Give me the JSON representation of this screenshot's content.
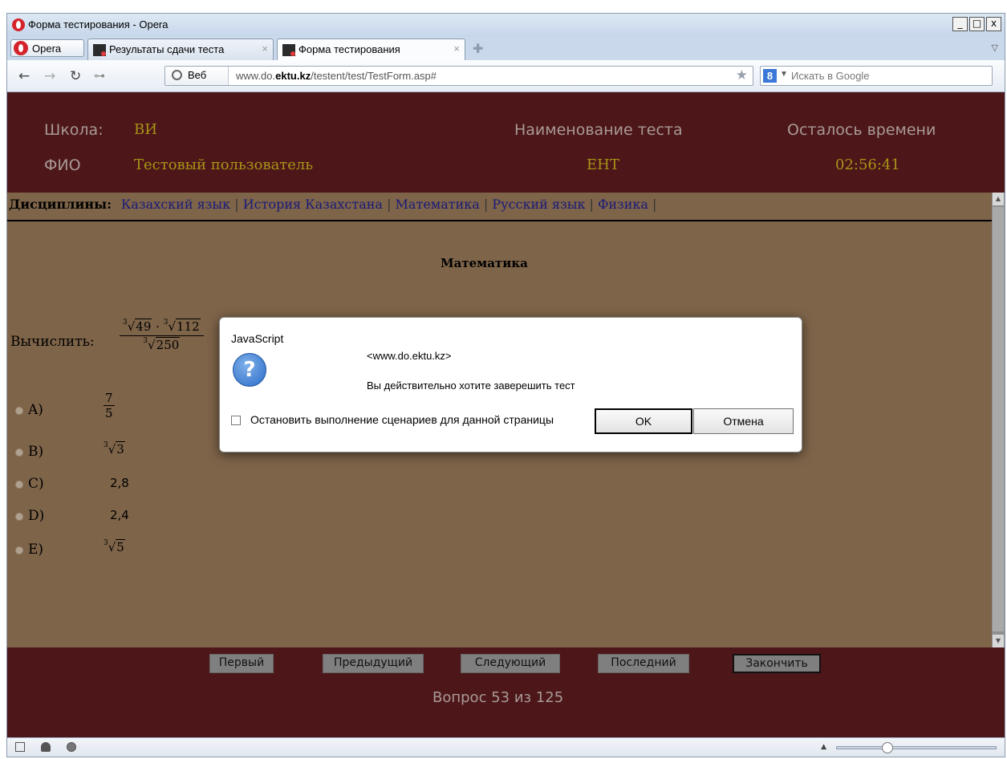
{
  "window": {
    "title": "Форма тестирования - Opera",
    "controls": [
      "_",
      "□",
      "x"
    ]
  },
  "tabs": {
    "opera_menu": "Opera",
    "items": [
      {
        "label": "Результаты сдачи теста",
        "close": "×",
        "active": false
      },
      {
        "label": "Форма тестирования",
        "close": "×",
        "active": true
      }
    ],
    "new_tab": "✚"
  },
  "toolbar": {
    "web_button": "Веб",
    "url_prefix": "www.do.",
    "url_domain": "ektu.kz",
    "url_path": "/testent/test/TestForm.asp#",
    "search_engine": "8",
    "search_placeholder": "Искать в Google"
  },
  "header": {
    "school_label": "Школа:",
    "school_value": "ВИ",
    "name_label": "ФИО",
    "name_value": "Тестовый пользователь",
    "test_label": "Наименование теста",
    "test_value": "ЕНТ",
    "time_label": "Осталось времени",
    "time_value": "02:56:41"
  },
  "disciplines": {
    "label": "Дисциплины:",
    "items": [
      "Казахский язык",
      "История Казахстана",
      "Математика",
      "Русский язык",
      "Физика"
    ],
    "separator": "|"
  },
  "question": {
    "subject": "Математика",
    "prompt": "Вычислить:",
    "numerator": {
      "index1": "3",
      "radicand1": "49",
      "dot": "·",
      "index2": "3",
      "radicand2": "112"
    },
    "denominator": {
      "index": "3",
      "radicand": "250"
    },
    "options": [
      {
        "label": "A)",
        "value_num": "7",
        "value_den": "5"
      },
      {
        "label": "B)",
        "index": "3",
        "radicand": "3"
      },
      {
        "label": "C)",
        "value": "2,8"
      },
      {
        "label": "D)",
        "value": "2,4"
      },
      {
        "label": "E)",
        "index": "3",
        "radicand": "5"
      }
    ]
  },
  "footer": {
    "buttons": [
      "Первый",
      "Предыдущий",
      "Следующий",
      "Последний",
      "Закончить"
    ],
    "counter": "Вопрос 53 из 125"
  },
  "dialog": {
    "title": "JavaScript",
    "icon": "question-icon",
    "icon_glyph": "?",
    "host": "<www.do.ektu.kz>",
    "message": "Вы действительно хотите заверешить тест",
    "checkbox_label": "Остановить выполнение сценариев для данной страницы",
    "ok": "OK",
    "cancel": "Отмена"
  },
  "statusbar": {
    "zoom_level_fraction": 0.3
  },
  "colors": {
    "header_bg": "#4d1619",
    "page_bg": "#7e6449",
    "header_value": "#a89418",
    "link": "#1a1a7a"
  }
}
